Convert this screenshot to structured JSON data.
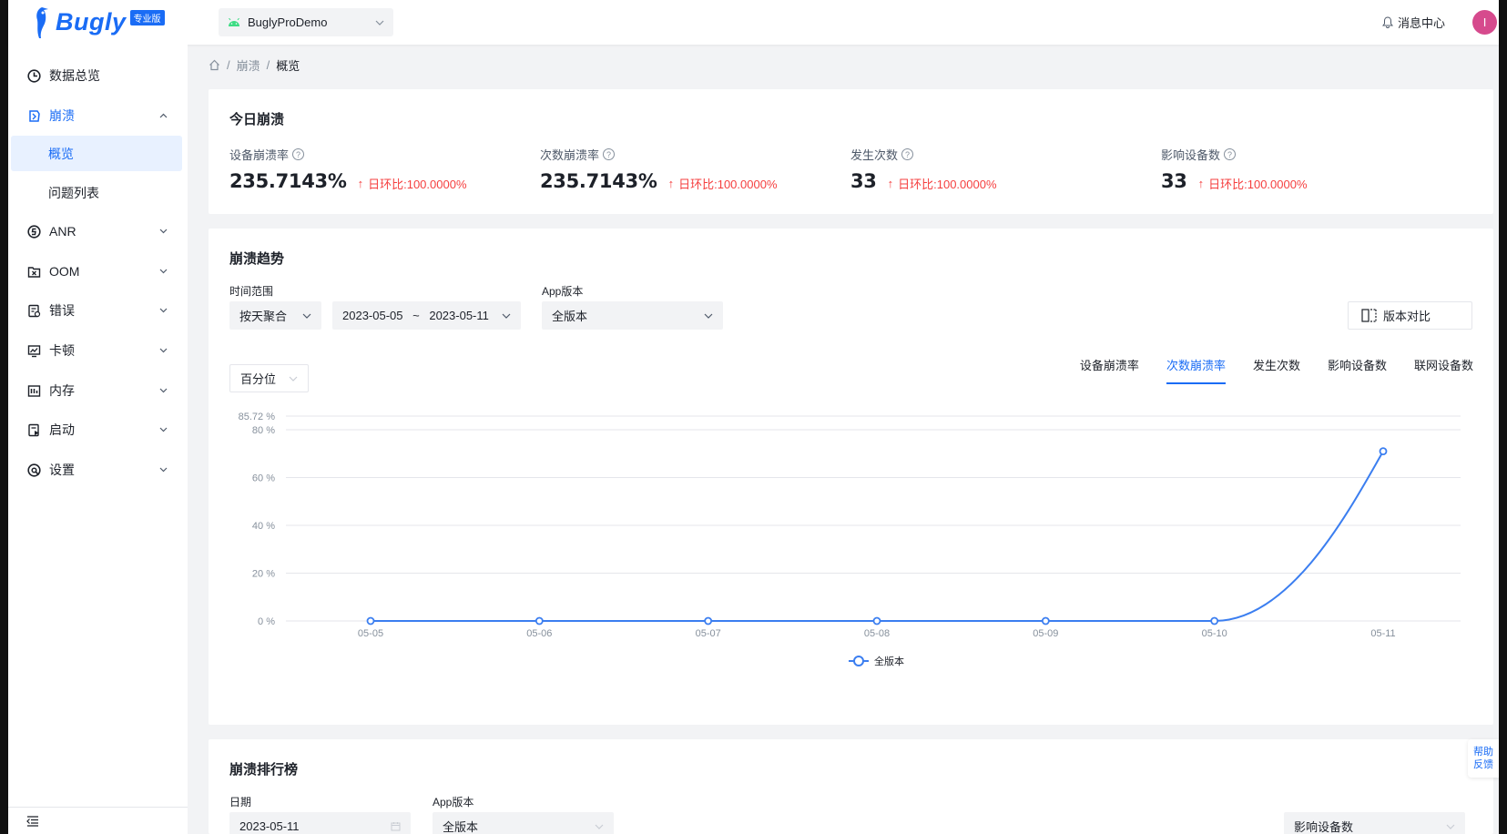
{
  "app": {
    "logo_text": "Bugly",
    "logo_badge": "专业版",
    "selected_app": "BuglyProDemo",
    "message_center": "消息中心",
    "avatar_letter": "I",
    "accent_color": "#1a6cf5"
  },
  "sidebar": {
    "items": [
      {
        "label": "数据总览",
        "icon": "dashboard-icon"
      },
      {
        "label": "崩溃",
        "icon": "crash-icon"
      },
      {
        "label": "概览"
      },
      {
        "label": "问题列表"
      },
      {
        "label": "ANR",
        "icon": "anr-icon"
      },
      {
        "label": "OOM",
        "icon": "oom-icon"
      },
      {
        "label": "错误",
        "icon": "error-icon"
      },
      {
        "label": "卡顿",
        "icon": "lag-icon"
      },
      {
        "label": "内存",
        "icon": "memory-icon"
      },
      {
        "label": "启动",
        "icon": "launch-icon"
      },
      {
        "label": "设置",
        "icon": "settings-icon"
      }
    ]
  },
  "breadcrumb": {
    "parent": "崩溃",
    "current": "概览",
    "separator": "/"
  },
  "today": {
    "title": "今日崩溃",
    "metrics": [
      {
        "label": "设备崩溃率",
        "value": "235.7143%",
        "change": "日环比:100.0000%"
      },
      {
        "label": "次数崩溃率",
        "value": "235.7143%",
        "change": "日环比:100.0000%"
      },
      {
        "label": "发生次数",
        "value": "33",
        "change": "日环比:100.0000%"
      },
      {
        "label": "影响设备数",
        "value": "33",
        "change": "日环比:100.0000%"
      }
    ]
  },
  "trend": {
    "title": "崩溃趋势",
    "time_range_label": "时间范围",
    "aggregation": "按天聚合",
    "date_start": "2023-05-05",
    "date_sep": "~",
    "date_end": "2023-05-11",
    "app_version_label": "App版本",
    "app_version": "全版本",
    "compare_button": "版本对比",
    "percentile": "百分位",
    "tabs": [
      "设备崩溃率",
      "次数崩溃率",
      "发生次数",
      "影响设备数",
      "联网设备数"
    ],
    "active_tab": "次数崩溃率"
  },
  "chart_data": {
    "type": "line",
    "categories": [
      "05-05",
      "05-06",
      "05-07",
      "05-08",
      "05-09",
      "05-10",
      "05-11"
    ],
    "series": [
      {
        "name": "全版本",
        "values": [
          0,
          0,
          0,
          0,
          0,
          0,
          71
        ],
        "color": "#3b7ef0"
      }
    ],
    "y_ticks": [
      "0 %",
      "20 %",
      "40 %",
      "60 %",
      "80 %",
      "85.72 %"
    ],
    "y_tick_values": [
      0,
      20,
      40,
      60,
      80,
      85.72
    ],
    "ylim": [
      0,
      85.72
    ],
    "grid": true,
    "legend": "bottom-center"
  },
  "ranking": {
    "title": "崩溃排行榜",
    "date_label": "日期",
    "date_value": "2023-05-11",
    "app_version_label": "App版本",
    "app_version": "全版本",
    "sort_by": "影响设备数"
  },
  "help": {
    "line1": "帮助",
    "line2": "反馈"
  }
}
